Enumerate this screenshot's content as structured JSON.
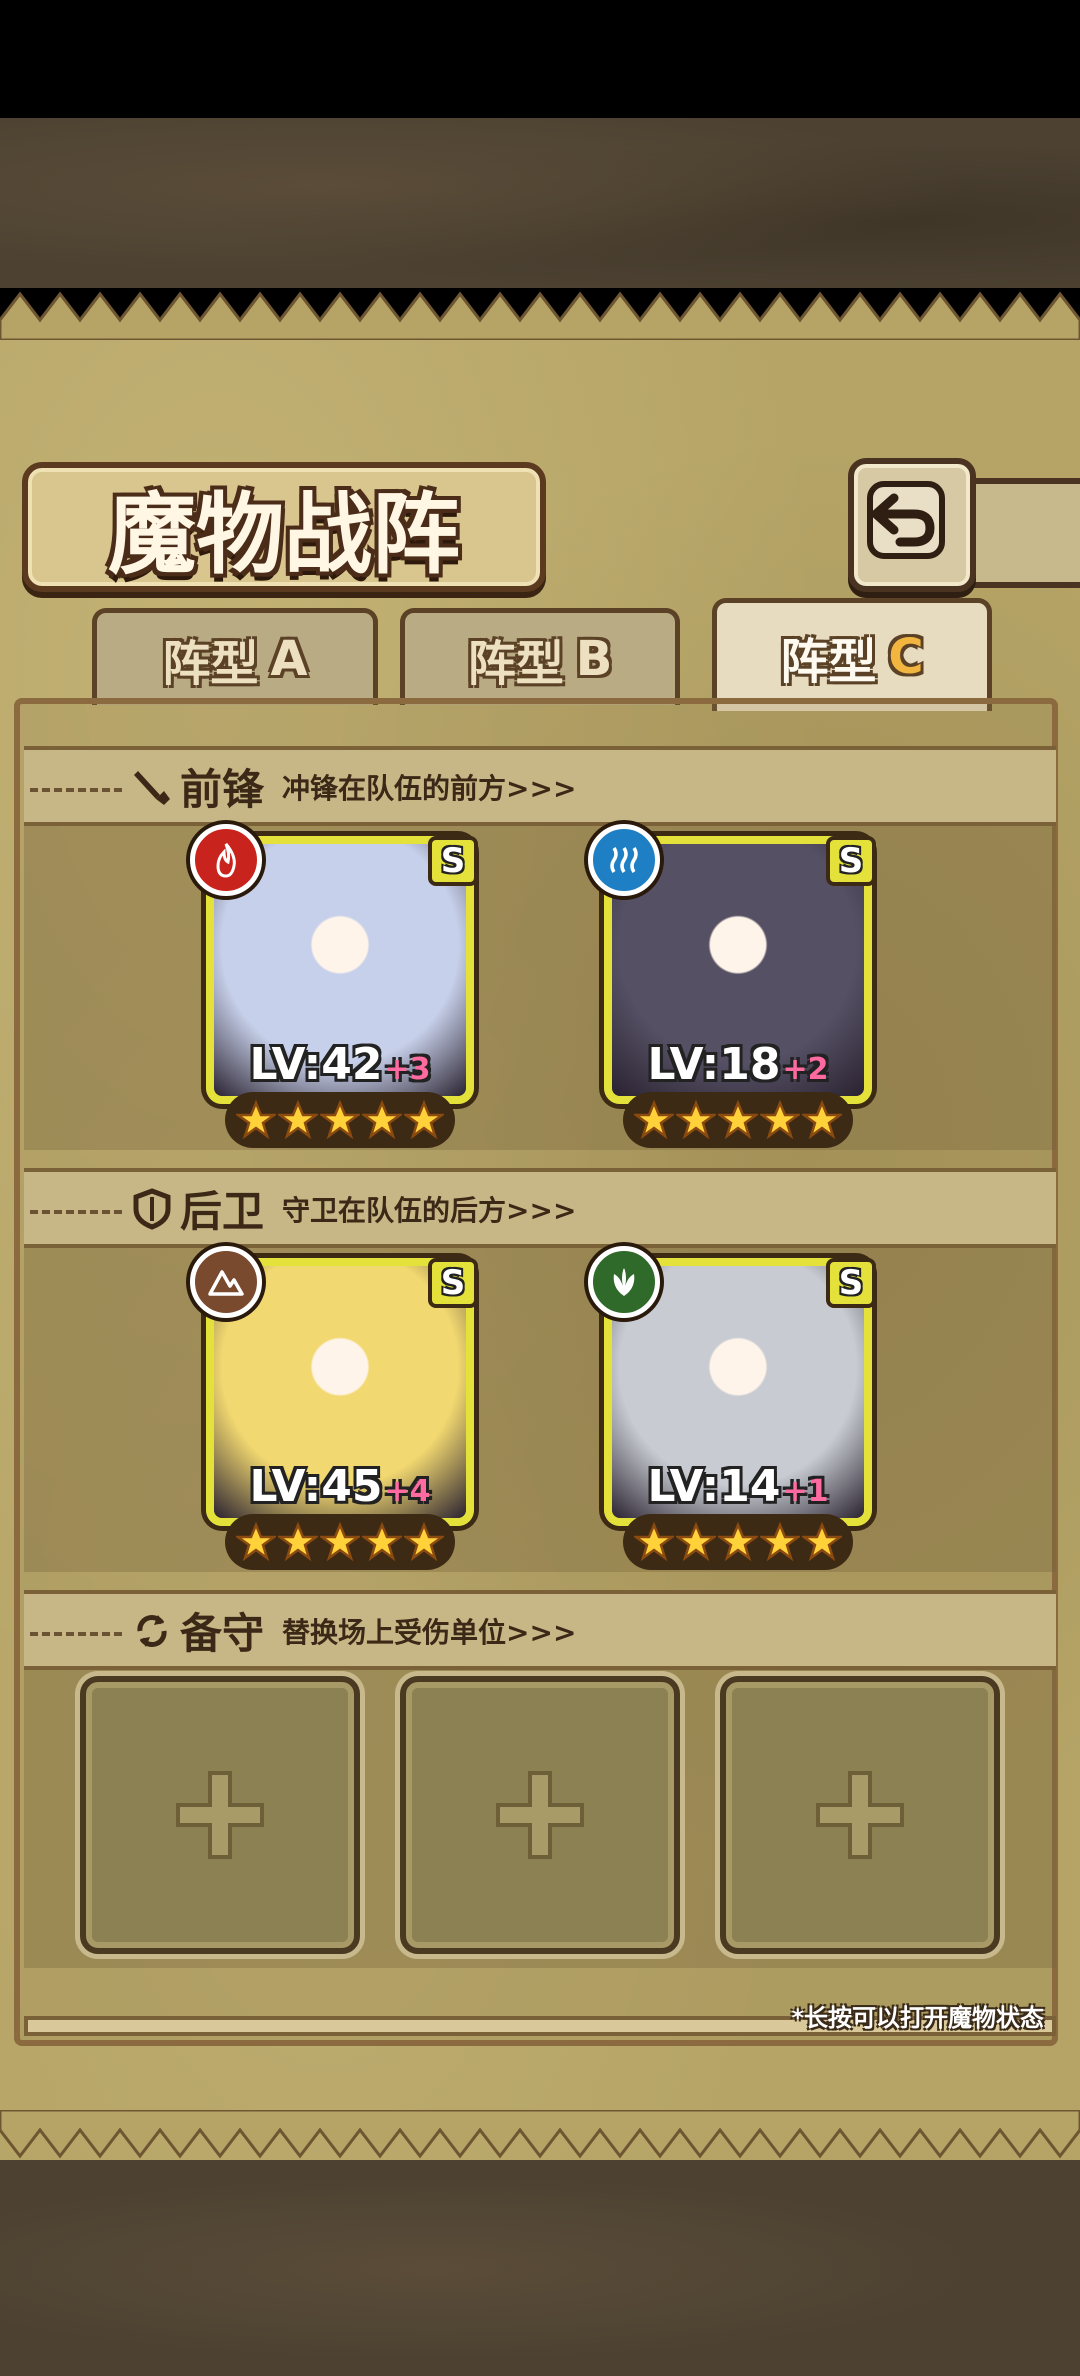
{
  "screen": {
    "title": "魔物战阵",
    "back_icon": "return-arrow-icon"
  },
  "tabs": [
    {
      "label": "阵型",
      "letter": "A",
      "active": false
    },
    {
      "label": "阵型",
      "letter": "B",
      "active": false
    },
    {
      "label": "阵型",
      "letter": "C",
      "active": true
    }
  ],
  "sections": {
    "front": {
      "icon": "sword-icon",
      "title": "前锋",
      "desc": "冲锋在队伍的前方>>>"
    },
    "back": {
      "icon": "shield-icon",
      "title": "后卫",
      "desc": "守卫在队伍的后方>>>"
    },
    "reserve": {
      "icon": "swap-icon",
      "title": "备守",
      "desc": "替换场上受伤单位>>>"
    }
  },
  "monsters": {
    "front": [
      {
        "element": "fire-icon",
        "element_color": "#c8231c",
        "rank": "S",
        "lv": "LV:42",
        "plus": "+3",
        "stars": 5,
        "art_color": "#c7d0ea"
      },
      {
        "element": "water-icon",
        "element_color": "#1f7fc4",
        "rank": "S",
        "lv": "LV:18",
        "plus": "+2",
        "stars": 5,
        "art_color": "#555064"
      }
    ],
    "back": [
      {
        "element": "earth-icon",
        "element_color": "#7a4a2e",
        "rank": "S",
        "lv": "LV:45",
        "plus": "+4",
        "stars": 5,
        "art_color": "#f2d870"
      },
      {
        "element": "leaf-icon",
        "element_color": "#2f6a2a",
        "rank": "S",
        "lv": "LV:14",
        "plus": "+1",
        "stars": 5,
        "art_color": "#c8ccd2"
      }
    ]
  },
  "reserve_slots": [
    {
      "icon": "plus-icon"
    },
    {
      "icon": "plus-icon"
    },
    {
      "icon": "plus-icon"
    }
  ],
  "hint": "*长按可以打开魔物状态"
}
